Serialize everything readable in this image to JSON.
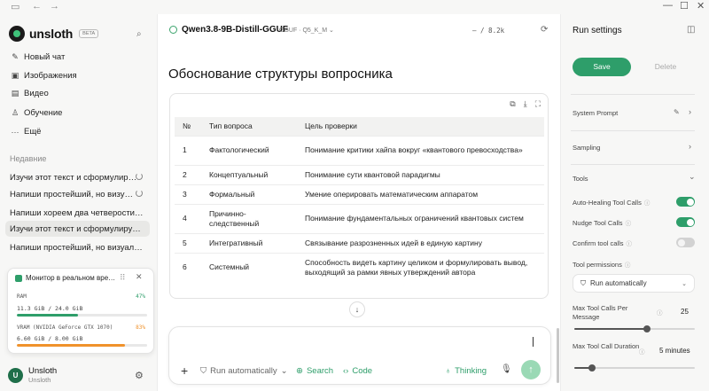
{
  "window": {
    "minimize": "—",
    "maximize": "☐",
    "close": "✕"
  },
  "sidebar": {
    "brand": "unsloth",
    "beta": "BETA",
    "menu": [
      {
        "label": "Новый чат",
        "icon": "new-chat-icon"
      },
      {
        "label": "Изображения",
        "icon": "image-icon"
      },
      {
        "label": "Видео",
        "icon": "video-icon"
      },
      {
        "label": "Обучение",
        "icon": "training-icon"
      },
      {
        "label": "Ещё",
        "icon": "more-icon"
      }
    ],
    "recent_label": "Недавние",
    "recent": [
      "Изучи этот текст и сформулир…",
      "Напиши простейший, но визу…",
      "Напиши хореем два четверости…",
      "Изучи этот текст и сформулируй …",
      "Напиши простейший, но визуальн…"
    ]
  },
  "monitor": {
    "title": "Монитор в реальном вре…",
    "ram_label": "RAM",
    "ram_pct": "47%",
    "ram_value": "11.3 GiB / 24.0 GiB",
    "ram_level": 0.47,
    "vram_label": "VRAM (NVIDIA GeForce GTX 1070)",
    "vram_pct": "83%",
    "vram_value": "6.60 GiB / 8.00 GiB",
    "vram_level": 0.83,
    "ram_color": "#2e9e6a",
    "vram_color": "#f0922b"
  },
  "user": {
    "initial": "U",
    "name": "Unsloth",
    "sub": "Unsloth"
  },
  "main": {
    "model_name": "Qwen3.8-9B-Distill-GGUF",
    "model_quant": "GGUF · Q5_K_M",
    "tokens": "– / 8.2k",
    "heading": "Обоснование структуры вопросника",
    "table": {
      "headers": [
        "№",
        "Тип вопроса",
        "Цель проверки"
      ],
      "rows": [
        [
          "1",
          "Фактологический",
          "Понимание критики хайпа вокруг «квантового превосходства»"
        ],
        [
          "2",
          "Концептуальный",
          "Понимание сути квантовой парадигмы"
        ],
        [
          "3",
          "Формальный",
          "Умение оперировать математическим аппаратом"
        ],
        [
          "4",
          "Причинно-следственный",
          "Понимание фундаментальных ограничений квантовых систем"
        ],
        [
          "5",
          "Интегративный",
          "Связывание разрозненных идей в единую картину"
        ],
        [
          "6",
          "Системный",
          "Способность видеть картину целиком и формулировать вывод, выходящий за рамки явных утверждений автора"
        ]
      ]
    },
    "composer": {
      "auto_run": "Run automatically",
      "search": "Search",
      "code": "Code",
      "thinking": "Thinking"
    }
  },
  "right_panel": {
    "title": "Run settings",
    "save": "Save",
    "delete": "Delete",
    "system_prompt": "System Prompt",
    "sampling": "Sampling",
    "tools": "Tools",
    "auto_healing": "Auto-Healing Tool Calls",
    "auto_healing_on": true,
    "nudge": "Nudge Tool Calls",
    "nudge_on": true,
    "confirm": "Confirm tool calls",
    "confirm_on": false,
    "permissions": "Tool permissions",
    "permission_value": "Run automatically",
    "max_calls_label": "Max Tool Calls Per Message",
    "max_calls_value": "25",
    "max_calls_level": 0.6,
    "max_duration_label": "Max Tool Call Duration",
    "max_duration_value": "5 minutes",
    "max_duration_level": 0.15
  }
}
